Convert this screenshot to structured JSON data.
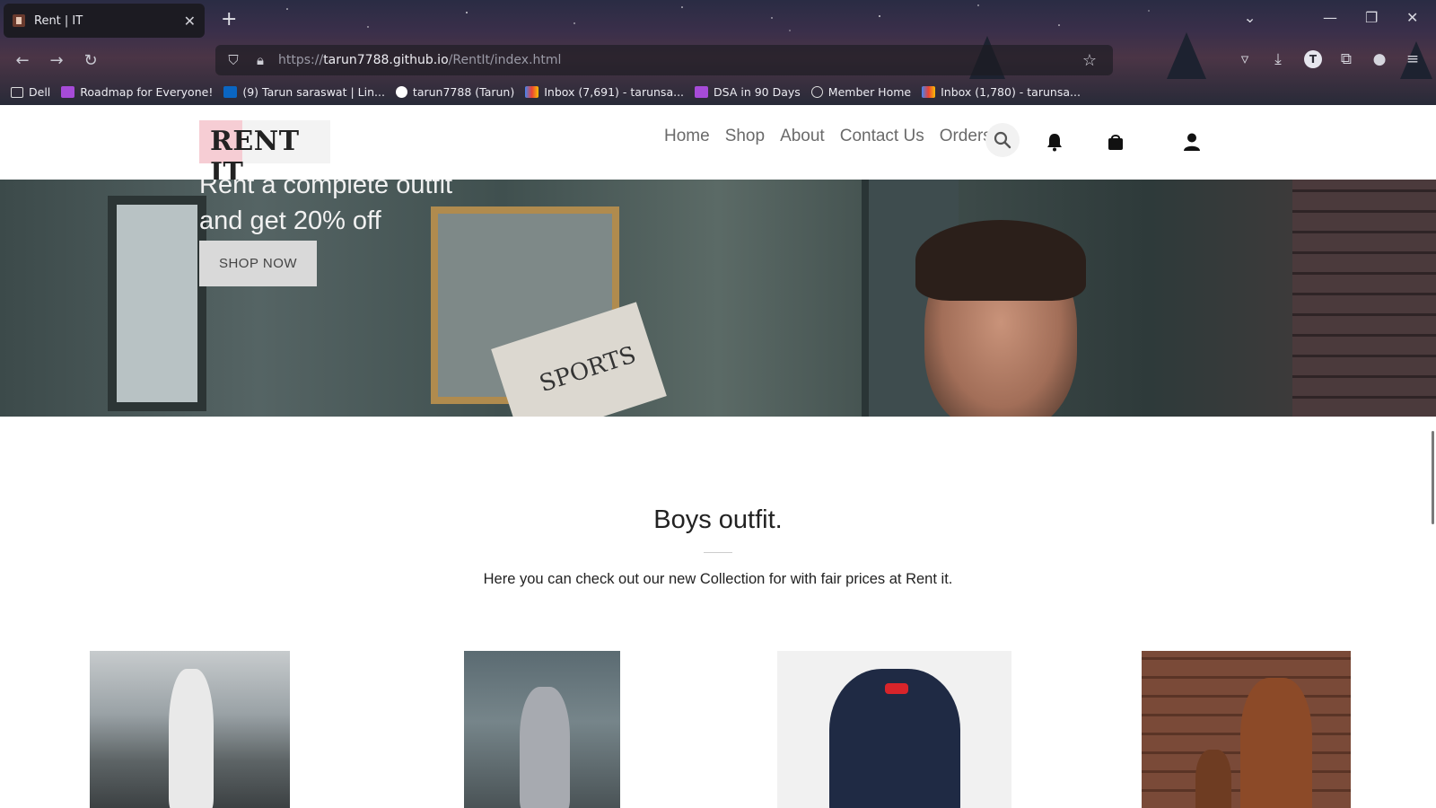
{
  "browser": {
    "tab_title": "Rent | IT",
    "url_prefix": "https://",
    "url_domain": "tarun7788.github.io",
    "url_path": "/RentIt/index.html",
    "profile_initial": "T",
    "bookmarks": [
      {
        "label": "Dell",
        "icon": "folder-icon",
        "color": "#ffffff"
      },
      {
        "label": "Roadmap for Everyone!",
        "icon": "roadmap-icon",
        "color": "#a64bd8"
      },
      {
        "label": "(9) Tarun saraswat | Lin...",
        "icon": "linkedin-icon",
        "color": "#0a66c2"
      },
      {
        "label": "tarun7788 (Tarun)",
        "icon": "github-icon",
        "color": "#ffffff"
      },
      {
        "label": "Inbox (7,691) - tarunsa...",
        "icon": "gmail-icon",
        "color": "#ea4335"
      },
      {
        "label": "DSA in 90 Days",
        "icon": "roadmap-icon",
        "color": "#a64bd8"
      },
      {
        "label": "Member Home",
        "icon": "globe-icon",
        "color": "#ffffff"
      },
      {
        "label": "Inbox (1,780) - tarunsa...",
        "icon": "gmail-icon",
        "color": "#ea4335"
      }
    ]
  },
  "site": {
    "logo_text": "RENT IT",
    "nav": [
      "Home",
      "Shop",
      "About",
      "Contact Us",
      "Orders"
    ],
    "accent_pink": "#f6cdd4"
  },
  "hero": {
    "line1": "Rent a complete outfit",
    "line2": "and get 20% off",
    "cta": "SHOP NOW",
    "newspaper_text": "SPORTS"
  },
  "section": {
    "title": "Boys outfit.",
    "subtitle": "Here you can check out our new Collection for with fair prices at Rent it."
  }
}
